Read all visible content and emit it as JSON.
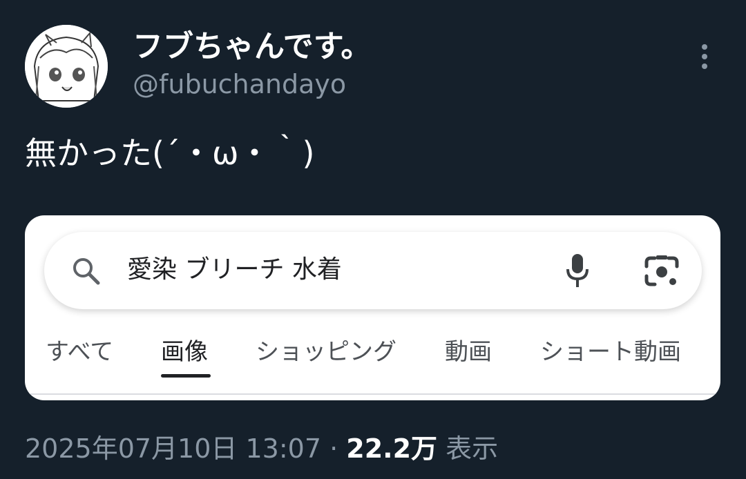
{
  "tweet": {
    "author": {
      "display_name": "フブちゃんです。",
      "handle": "@fubuchandayo"
    },
    "text": "無かった(´・ω・｀)",
    "timestamp": "2025年07月10日 13:07",
    "separator": "·",
    "views_count": "22.2万",
    "views_label": "表示"
  },
  "embedded_image": {
    "search": {
      "query": "愛染 ブリーチ 水着",
      "icons": [
        "search-icon",
        "microphone-icon",
        "camera-lens-icon"
      ]
    },
    "tabs": [
      {
        "label": "すべて",
        "active": false
      },
      {
        "label": "画像",
        "active": true
      },
      {
        "label": "ショッピング",
        "active": false
      },
      {
        "label": "動画",
        "active": false
      },
      {
        "label": "ショート動画",
        "active": false
      }
    ]
  },
  "colors": {
    "background": "#15202b",
    "secondary_text": "#8b98a5",
    "primary_text": "#ffffff"
  }
}
